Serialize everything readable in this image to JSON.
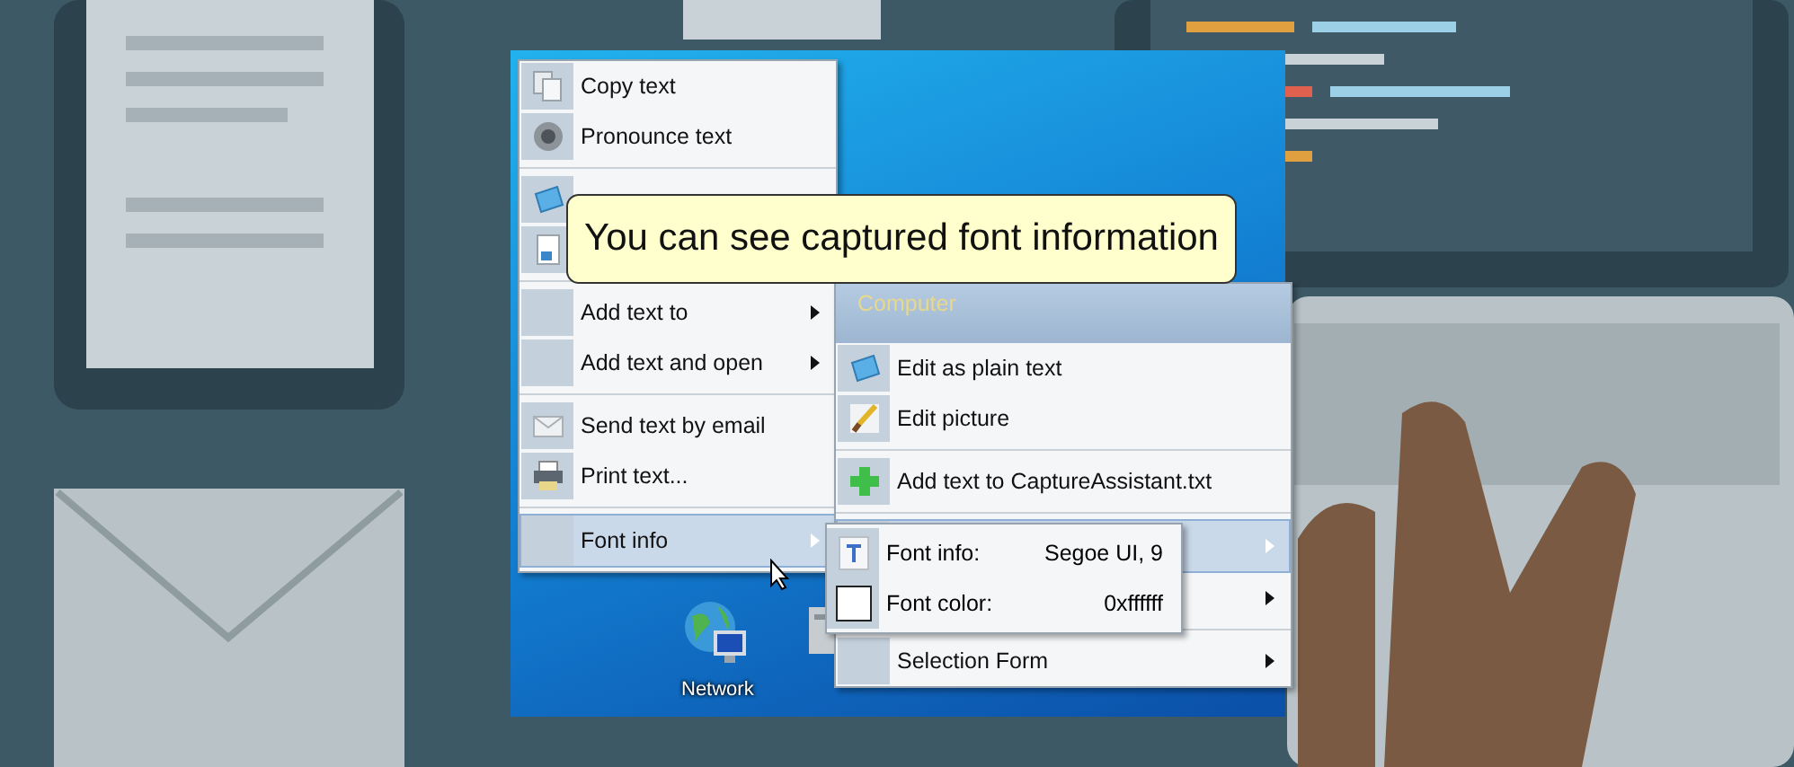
{
  "desktop": {
    "icons": [
      {
        "label": "Network"
      }
    ]
  },
  "context_menu": {
    "items": [
      {
        "kind": "item",
        "label": "Copy text",
        "submenu": false,
        "selected": false
      },
      {
        "kind": "item",
        "label": "Pronounce text",
        "submenu": false,
        "selected": false
      },
      {
        "kind": "separator"
      },
      {
        "kind": "blank",
        "selected": false
      },
      {
        "kind": "blank",
        "selected": false
      },
      {
        "kind": "separator"
      },
      {
        "kind": "item",
        "label": "Add text to",
        "submenu": true,
        "selected": false
      },
      {
        "kind": "item",
        "label": "Add text and open",
        "submenu": true,
        "selected": false
      },
      {
        "kind": "separator"
      },
      {
        "kind": "item",
        "label": "Send text by email",
        "submenu": false,
        "selected": false
      },
      {
        "kind": "item",
        "label": "Print text...",
        "submenu": false,
        "selected": false
      },
      {
        "kind": "separator"
      },
      {
        "kind": "item",
        "label": "Font info",
        "submenu": true,
        "selected": true
      }
    ]
  },
  "capture_menu": {
    "header": "Computer",
    "items": [
      {
        "kind": "item",
        "label": "Edit as plain text",
        "submenu": false,
        "selected": false
      },
      {
        "kind": "item",
        "label": "Edit picture",
        "submenu": false,
        "selected": false
      },
      {
        "kind": "separator"
      },
      {
        "kind": "item",
        "label": "Add text to CaptureAssistant.txt",
        "submenu": false,
        "selected": false
      },
      {
        "kind": "separator"
      },
      {
        "kind": "blank",
        "submenu": true,
        "selected": true
      },
      {
        "kind": "blank",
        "submenu": true,
        "selected": false
      },
      {
        "kind": "separator"
      },
      {
        "kind": "item",
        "label": "Selection Form",
        "submenu": true,
        "selected": false
      }
    ]
  },
  "font_submenu": {
    "rows": [
      {
        "label": "Font info:",
        "value": "Segoe UI, 9"
      },
      {
        "label": "Font color:",
        "value": "0xffffff",
        "color": "#ffffff"
      }
    ]
  },
  "tooltip": {
    "text": "You can see captured font information"
  }
}
